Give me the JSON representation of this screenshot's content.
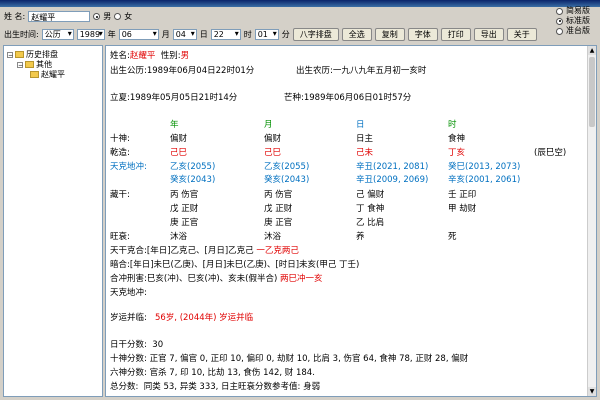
{
  "toolbar": {
    "name_label": "姓  名:",
    "name_value": "赵耀平",
    "gender_male": "男",
    "gender_female": "女",
    "birth_label": "出生时间:",
    "calendar_select": "公历",
    "year_value": "1989",
    "year_label": "年",
    "month_value": "06",
    "month_label": "月",
    "day_value": "04",
    "day_label": "日",
    "hour_value": "22",
    "hour_label": "时",
    "minute_value": "01",
    "minute_label": "分",
    "buttons": [
      "八字排盘",
      "全选",
      "复制",
      "字体",
      "打印",
      "导出",
      "关于"
    ],
    "modes": [
      "简易版",
      "标准版",
      "准台版"
    ]
  },
  "tree": {
    "root": "历史排盘",
    "child": "其他",
    "leaf": "赵耀平"
  },
  "content": {
    "name_line": {
      "label": "姓名:",
      "name": "赵耀平",
      "gender_label": "性别:",
      "gender": "男"
    },
    "solar_line": "出生公历:1989年06月04日22时01分",
    "lunar_line": "出生农历:一九八九年五月初一亥时",
    "terms_line": {
      "a": "立夏:1989年05月05日21时14分",
      "b": "芒种:1989年06月06日01时57分"
    },
    "pillars": [
      "年",
      "月",
      "日",
      "时"
    ],
    "shishen_label": "十神:",
    "shishen": [
      "偏财",
      "偏财",
      "日主",
      "食神"
    ],
    "qianzao_label": "乾造:",
    "qianzao": [
      "己巳",
      "己巳",
      "己未",
      "丁亥"
    ],
    "kongwang": "(辰巳空)",
    "tiankedichong_label": "天克地冲:",
    "tkdc_row1": [
      "乙亥(2055)",
      "乙亥(2055)",
      "辛丑(2021, 2081)",
      "癸巳(2013, 2073)"
    ],
    "tkdc_row2": [
      "癸亥(2043)",
      "癸亥(2043)",
      "辛丑(2009, 2069)",
      "辛亥(2001, 2061)"
    ],
    "canggan_label": "藏干:",
    "canggan_row1": [
      "丙  伤官",
      "丙  伤官",
      "己  偏财",
      "壬  正印"
    ],
    "canggan_row2": [
      "戊  正财",
      "戊  正财",
      "丁  食神",
      "甲  劫财"
    ],
    "canggan_row3": [
      "庚  正官",
      "庚  正官",
      "乙  比肩",
      ""
    ],
    "wangshuai_label": "旺衰:",
    "wangshuai": [
      "沐浴",
      "沐浴",
      "养",
      "死"
    ],
    "tiangan_label": "天干克合:",
    "tiangan_text": "[年日]乙克己、[月日]乙克己",
    "tiangan_red": "一乙克两己",
    "anhe_label": "暗合:",
    "anhe_text": "[年日]未巳(乙庚)、[月日]未巳(乙庚)、[时日]未亥(甲己 丁壬)",
    "hexing_label": "合冲刑害:",
    "hexing_text": "巳亥(冲)、巳亥(冲)、亥未(假半合)",
    "hexing_red": "两巳冲一亥",
    "tiankedichong2_label": "天克地冲:",
    "suiyun_label": "岁运并临:",
    "suiyun_value": "56岁, (2044年) 岁运并临",
    "rigan_label": "日干分数:",
    "rigan_value": "30",
    "shishenfen_label": "十神分数:",
    "shishenfen_value": "正官 7, 偏官 0, 正印 10, 偏印 0, 劫财 10, 比肩 3, 伤官 64, 食神 78, 正财 28, 偏财",
    "liushen_label": "六神分数:",
    "liushen_value": "官杀 7, 印 10, 比劫 13, 食伤 142, 财 184.",
    "zongfen_label": "总分数:",
    "zongfen_value": "同类 53, 异类 333, 日主旺衰分数参考值: 身弱"
  }
}
